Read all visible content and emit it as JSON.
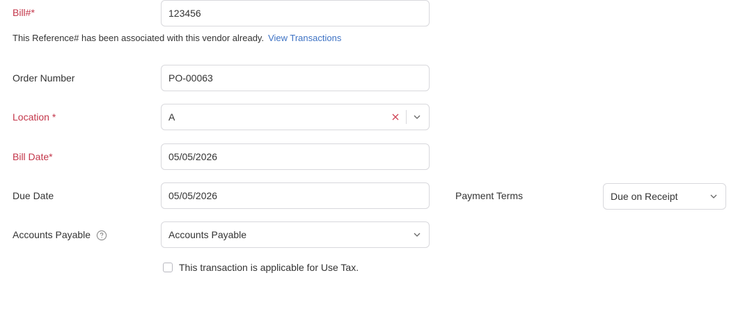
{
  "bill": {
    "label": "Bill#*",
    "value": "123456",
    "warning_text": "This Reference# has been associated with this vendor already.",
    "warning_link": "View Transactions"
  },
  "order_number": {
    "label": "Order Number",
    "value": "PO-00063"
  },
  "location": {
    "label": "Location *",
    "value": "A"
  },
  "bill_date": {
    "label": "Bill Date*",
    "value": "05/05/2026"
  },
  "due_date": {
    "label": "Due Date",
    "value": "05/05/2026"
  },
  "payment_terms": {
    "label": "Payment Terms",
    "value": "Due on Receipt"
  },
  "accounts_payable": {
    "label": "Accounts Payable",
    "value": "Accounts Payable"
  },
  "use_tax": {
    "label": "This transaction is applicable for Use Tax.",
    "checked": false
  },
  "colors": {
    "required_label": "#c3364a",
    "link": "#3d72c4",
    "border": "#d8d8dc",
    "text": "#333333"
  },
  "icons": {
    "help": "question-circle-icon",
    "clear": "close-icon",
    "dropdown": "chevron-down-icon"
  }
}
